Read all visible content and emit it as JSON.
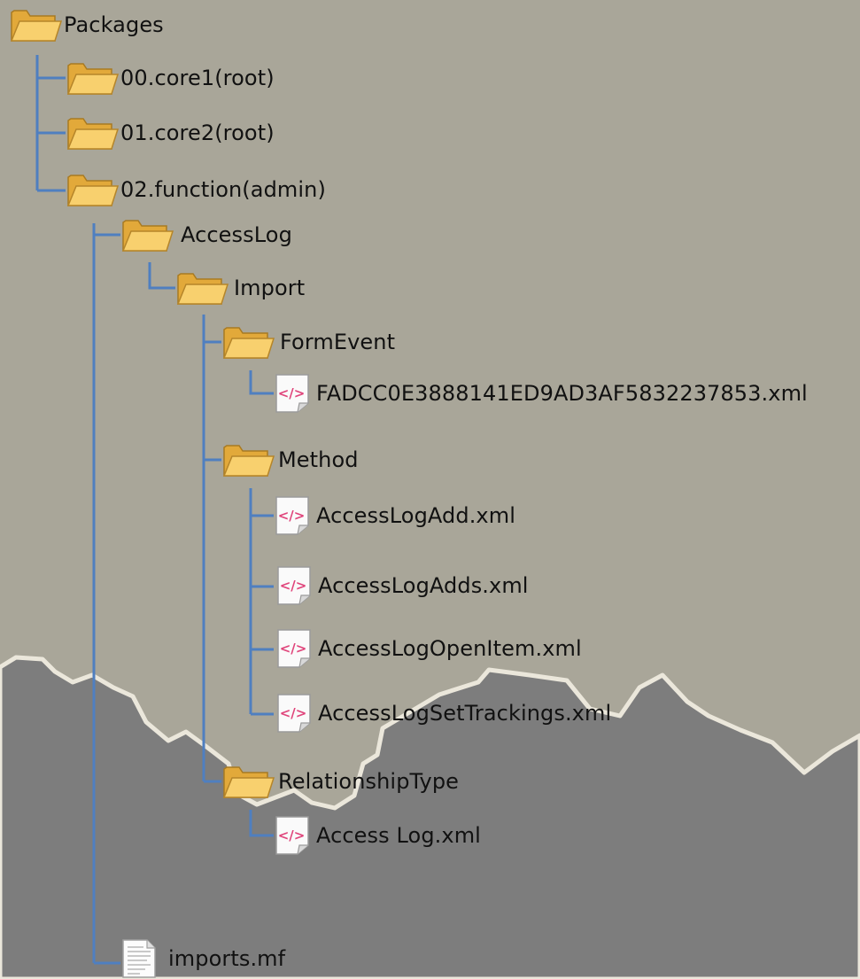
{
  "tree": {
    "root": "Packages",
    "folders": {
      "core1": "00.core1(root)",
      "core2": "01.core2(root)",
      "function": "02.function(admin)",
      "accesslog": "AccessLog",
      "import": "Import",
      "formevent": "FormEvent",
      "method": "Method",
      "relationshiptype": "RelationshipType"
    },
    "files": {
      "formevent_xml": "FADCC0E3888141ED9AD3AF5832237853.xml",
      "add": "AccessLogAdd.xml",
      "adds": "AccessLogAdds.xml",
      "openitem": "AccessLogOpenItem.xml",
      "settrackings": "AccessLogSetTrackings.xml",
      "access_log": "Access Log.xml",
      "imports_mf": "imports.mf"
    }
  },
  "colors": {
    "background_light": "#a9a699",
    "background_gear": "#7d7d7d",
    "gear_edge": "#e8e4d8",
    "connector": "#4f7fc0",
    "folder": "#f6c860",
    "xml_tag": "#e0457b"
  },
  "icons": {
    "folder": "open-folder-icon",
    "xml": "xml-file-icon",
    "manifest": "text-document-icon"
  }
}
